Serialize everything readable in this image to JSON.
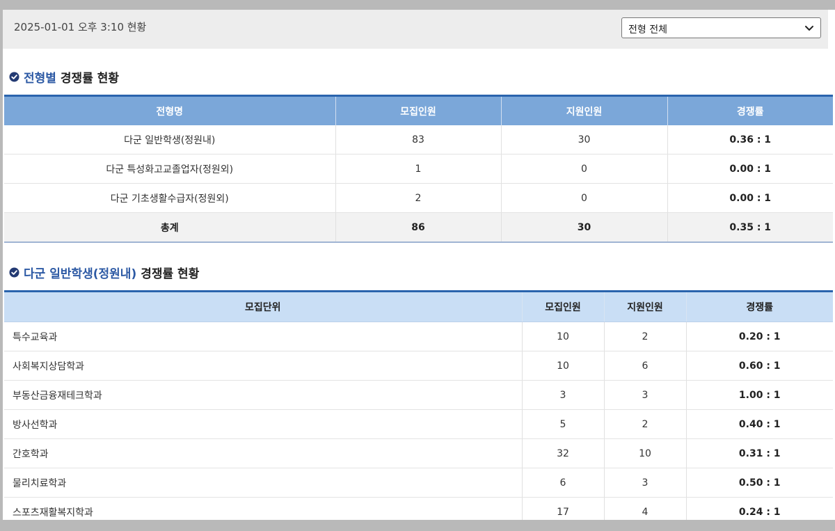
{
  "header": {
    "timestamp": "2025-01-01 오후 3:10 현황",
    "filter_select": {
      "value": "전형 전체"
    }
  },
  "section1": {
    "title_highlight": "전형별",
    "title_rest": "경쟁률 현황",
    "columns": [
      "전형명",
      "모집인원",
      "지원인원",
      "경쟁률"
    ],
    "rows": [
      {
        "name": "다군 일반학생(정원내)",
        "quota": "83",
        "applicants": "30",
        "ratio": "0.36 : 1"
      },
      {
        "name": "다군 특성화고교졸업자(정원외)",
        "quota": "1",
        "applicants": "0",
        "ratio": "0.00 : 1"
      },
      {
        "name": "다군 기초생활수급자(정원외)",
        "quota": "2",
        "applicants": "0",
        "ratio": "0.00 : 1"
      }
    ],
    "total": {
      "name": "총계",
      "quota": "86",
      "applicants": "30",
      "ratio": "0.35 : 1"
    }
  },
  "section2": {
    "title_highlight": "다군 일반학생(정원내)",
    "title_rest": "경쟁률 현황",
    "columns": [
      "모집단위",
      "모집인원",
      "지원인원",
      "경쟁률"
    ],
    "rows": [
      {
        "unit": "특수교육과",
        "quota": "10",
        "applicants": "2",
        "ratio": "0.20 : 1"
      },
      {
        "unit": "사회복지상담학과",
        "quota": "10",
        "applicants": "6",
        "ratio": "0.60 : 1"
      },
      {
        "unit": "부동산금융재테크학과",
        "quota": "3",
        "applicants": "3",
        "ratio": "1.00 : 1"
      },
      {
        "unit": "방사선학과",
        "quota": "5",
        "applicants": "2",
        "ratio": "0.40 : 1"
      },
      {
        "unit": "간호학과",
        "quota": "32",
        "applicants": "10",
        "ratio": "0.31 : 1"
      },
      {
        "unit": "물리치료학과",
        "quota": "6",
        "applicants": "3",
        "ratio": "0.50 : 1"
      },
      {
        "unit": "스포츠재활복지학과",
        "quota": "17",
        "applicants": "4",
        "ratio": "0.24 : 1"
      }
    ]
  },
  "colors": {
    "accent_blue": "#2a64ad",
    "header_blue": "#7ba7d9",
    "header_light_blue": "#c9def5"
  },
  "icons": {
    "section_marker": "check-circle-icon",
    "select_arrow": "chevron-down-icon"
  }
}
